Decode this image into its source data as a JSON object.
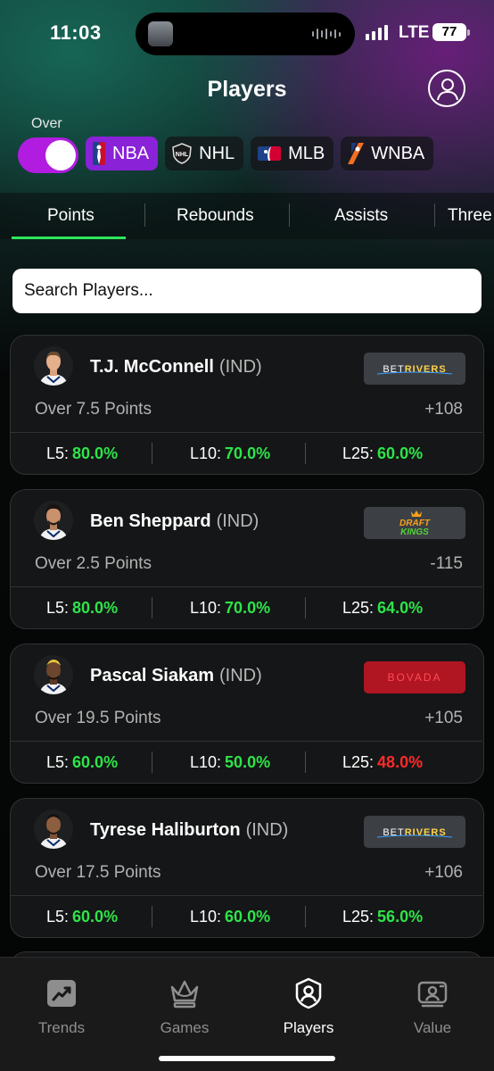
{
  "status_bar": {
    "time": "11:03",
    "network": "LTE",
    "battery": "77"
  },
  "header": {
    "title": "Players",
    "profile_icon": "person-circle-icon"
  },
  "toggle": {
    "label": "Over",
    "state": "on",
    "color": "#b21be0"
  },
  "leagues": [
    {
      "label": "NBA",
      "active": true,
      "icon": "nba-logo-icon"
    },
    {
      "label": "NHL",
      "active": false,
      "icon": "nhl-logo-icon"
    },
    {
      "label": "MLB",
      "active": false,
      "icon": "mlb-logo-icon"
    },
    {
      "label": "WNBA",
      "active": false,
      "icon": "wnba-logo-icon"
    }
  ],
  "tabs": [
    {
      "label": "Points",
      "active": true
    },
    {
      "label": "Rebounds",
      "active": false
    },
    {
      "label": "Assists",
      "active": false
    },
    {
      "label": "Three",
      "active": false
    }
  ],
  "search": {
    "placeholder": "Search Players..."
  },
  "players": [
    {
      "name": "T.J. McConnell",
      "team": "(IND)",
      "book": "BETRIVERS",
      "line": "Over 7.5  Points",
      "odds": "+108",
      "l5_label": "L5:",
      "l5": "80.0%",
      "l10_label": "L10:",
      "l10": "70.0%",
      "l25_label": "L25:",
      "l25": "60.0%"
    },
    {
      "name": "Ben Sheppard",
      "team": "(IND)",
      "book": "DRAFT KINGS",
      "line": "Over 2.5  Points",
      "odds": "-115",
      "l5_label": "L5:",
      "l5": "80.0%",
      "l10_label": "L10:",
      "l10": "70.0%",
      "l25_label": "L25:",
      "l25": "64.0%"
    },
    {
      "name": "Pascal Siakam",
      "team": "(IND)",
      "book": "BOVADA",
      "line": "Over 19.5  Points",
      "odds": "+105",
      "l5_label": "L5:",
      "l5": "60.0%",
      "l10_label": "L10:",
      "l10": "50.0%",
      "l25_label": "L25:",
      "l25": "48.0%"
    },
    {
      "name": "Tyrese Haliburton",
      "team": "(IND)",
      "book": "BETRIVERS",
      "line": "Over 17.5  Points",
      "odds": "+106",
      "l5_label": "L5:",
      "l5": "60.0%",
      "l10_label": "L10:",
      "l10": "60.0%",
      "l25_label": "L25:",
      "l25": "56.0%"
    }
  ],
  "colors": {
    "positive": "#2ee44a",
    "negative": "#ff2a2a",
    "accent": "#8a22d8",
    "tab_underline": "#2ee75a"
  },
  "bottom_nav": [
    {
      "label": "Trends",
      "icon": "trends-chart-icon",
      "active": false
    },
    {
      "label": "Games",
      "icon": "crown-icon",
      "active": false
    },
    {
      "label": "Players",
      "icon": "player-badge-icon",
      "active": true
    },
    {
      "label": "Value",
      "icon": "value-ticket-icon",
      "active": false
    }
  ]
}
